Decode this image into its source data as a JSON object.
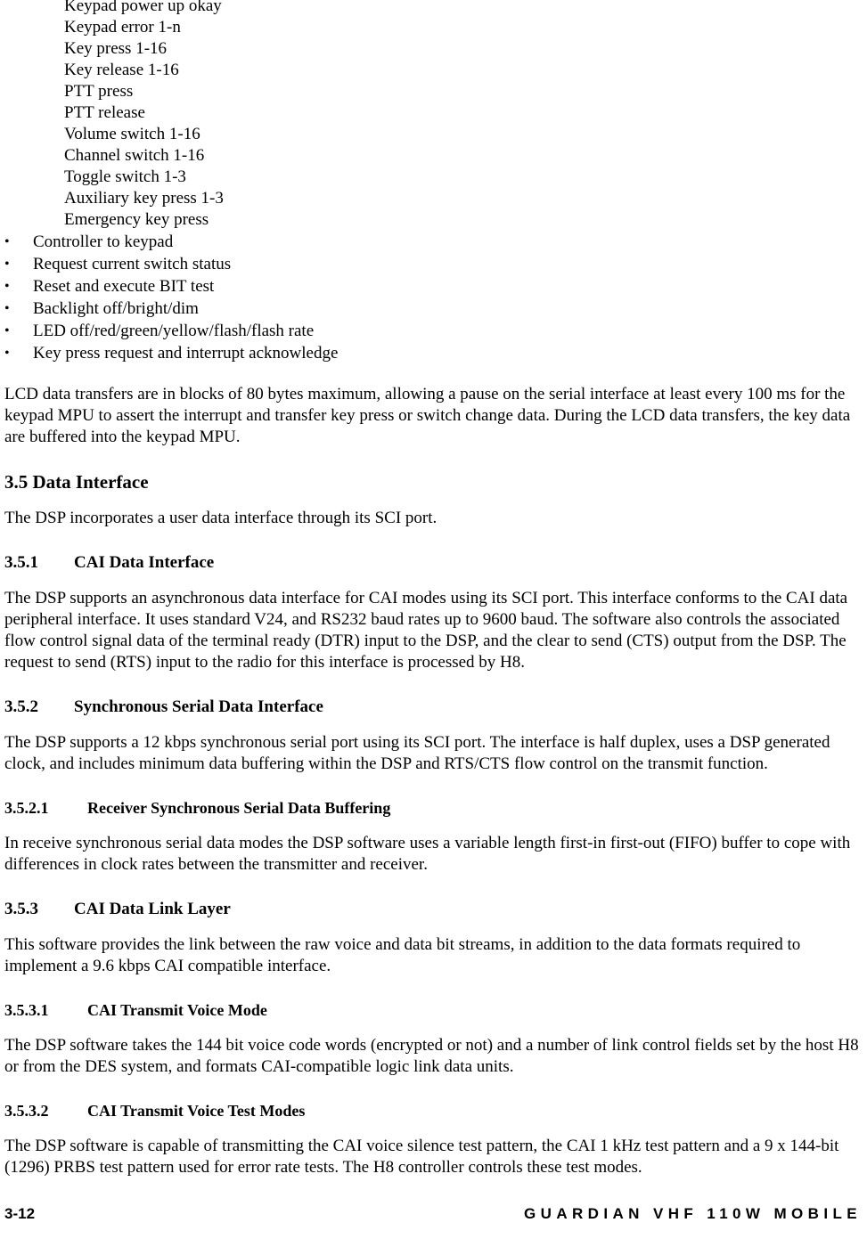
{
  "document": {
    "keypad_messages": [
      "Keypad power up okay",
      "Keypad error 1-n",
      "Key press 1-16",
      "Key release 1-16",
      "PTT press",
      "PTT release",
      "Volume switch 1-16",
      "Channel switch 1-16",
      "Toggle switch 1-3",
      "Auxiliary key press 1-3",
      "Emergency key press"
    ],
    "bullet_marker": "•",
    "controller_bullets": [
      "Controller to keypad",
      "Request current switch status",
      "Reset and execute BIT test",
      "Backlight off/bright/dim",
      "LED off/red/green/yellow/flash/flash rate",
      "Key press request and interrupt acknowledge"
    ],
    "lcd_paragraph": "LCD data transfers are in blocks of 80 bytes maximum, allowing a pause on the serial interface at least every 100 ms for the keypad MPU to assert the interrupt and transfer key press or switch change data. During the LCD data transfers, the key data are buffered into the keypad MPU.",
    "section_3_5": {
      "heading": "3.5 Data Interface",
      "paragraph": "The DSP incorporates a user data interface through its SCI port."
    },
    "section_3_5_1": {
      "number": "3.5.1",
      "title": "CAI Data Interface",
      "paragraph": "The DSP supports an asynchronous data interface for CAI modes using its SCI port.  This interface conforms to the CAI data peripheral interface.  It uses standard V24, and RS232 baud rates up to 9600 baud.  The software also controls the associated flow control signal data of the terminal ready (DTR) input to the DSP, and the clear to send (CTS) output from the DSP.  The request to send (RTS) input to the radio for this interface is processed by H8."
    },
    "section_3_5_2": {
      "number": "3.5.2",
      "title": "Synchronous Serial Data Interface",
      "paragraph": "The DSP supports a 12 kbps synchronous serial port using its SCI port. The interface is half duplex, uses a DSP generated clock, and includes minimum data buffering within the DSP and RTS/CTS flow control on the transmit function."
    },
    "section_3_5_2_1": {
      "number": "3.5.2.1",
      "title": "Receiver Synchronous Serial Data Buffering",
      "paragraph": "In receive synchronous serial data modes the DSP software uses a variable length first-in first-out (FIFO) buffer to cope with differences in clock rates between the transmitter and receiver."
    },
    "section_3_5_3": {
      "number": "3.5.3",
      "title": "CAI Data Link Layer",
      "paragraph": "This software provides the link between the raw voice and data bit streams, in addition to the data formats required to implement a 9.6 kbps CAI compatible interface."
    },
    "section_3_5_3_1": {
      "number": "3.5.3.1",
      "title": "CAI Transmit Voice Mode",
      "paragraph": "The DSP software takes the 144 bit voice code words (encrypted or not) and a number of link control fields set by the host H8 or from the DES system, and formats CAI-compatible logic link data units."
    },
    "section_3_5_3_2": {
      "number": "3.5.3.2",
      "title": "CAI Transmit Voice Test Modes",
      "paragraph": "The DSP software is capable of transmitting the CAI voice silence test pattern, the CAI 1 kHz test pattern and a 9 x 144-bit (1296) PRBS test pattern used for error rate tests.  The H8 controller controls these test modes."
    },
    "footer": {
      "page_number": "3-12",
      "title": "GUARDIAN VHF 110W MOBILE"
    }
  }
}
